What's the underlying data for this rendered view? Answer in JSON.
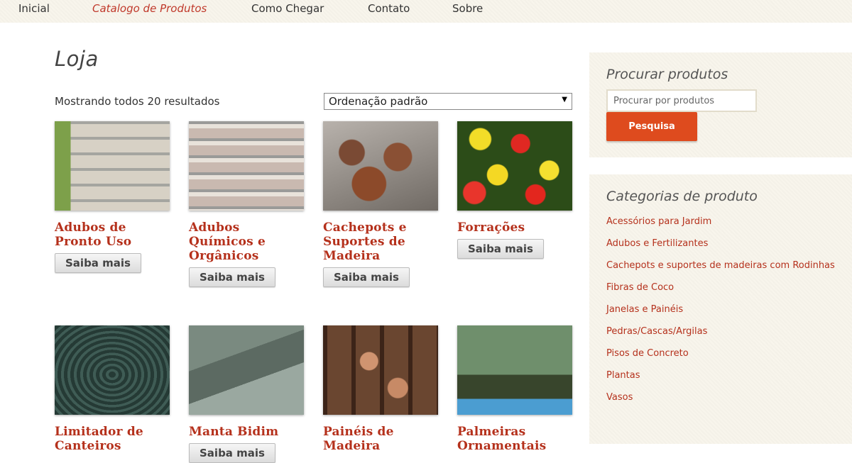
{
  "nav": {
    "items": [
      {
        "label": "Inicial",
        "active": false
      },
      {
        "label": "Catalogo de Produtos",
        "active": true
      },
      {
        "label": "Como Chegar",
        "active": false
      },
      {
        "label": "Contato",
        "active": false
      },
      {
        "label": "Sobre",
        "active": false
      }
    ]
  },
  "main": {
    "title": "Loja",
    "result_count": "Mostrando todos 20 resultados",
    "ordering": "Ordenação padrão",
    "button_label": "Saiba mais",
    "products": [
      {
        "name": "Adubos de Pronto Uso",
        "image": "shelves"
      },
      {
        "name": "Adubos Químicos e Orgânicos",
        "image": "shelves"
      },
      {
        "name": "Cachepots e Suportes de Madeira",
        "image": "pots"
      },
      {
        "name": "Forrações",
        "image": "flowers"
      },
      {
        "name": "Limitador de Canteiros",
        "image": "hose"
      },
      {
        "name": "Manta Bidim",
        "image": "fabric"
      },
      {
        "name": "Painéis de Madeira",
        "image": "panels"
      },
      {
        "name": "Palmeiras Ornamentais",
        "image": "palms"
      }
    ]
  },
  "sidebar": {
    "search": {
      "title": "Procurar produtos",
      "placeholder": "Procurar por produtos",
      "button": "Pesquisa"
    },
    "categories": {
      "title": "Categorias de produto",
      "items": [
        "Acessórios para Jardim",
        "Adubos e Fertilizantes",
        "Cachepots e suportes de madeiras com Rodinhas",
        "Fibras de Coco",
        "Janelas e Painéis",
        "Pedras/Cascas/Argilas",
        "Pisos de Concreto",
        "Plantas",
        "Vasos"
      ]
    }
  },
  "colors": {
    "accent": "#b5311c",
    "button": "#de4b1e",
    "panel": "#f8f5ec"
  }
}
